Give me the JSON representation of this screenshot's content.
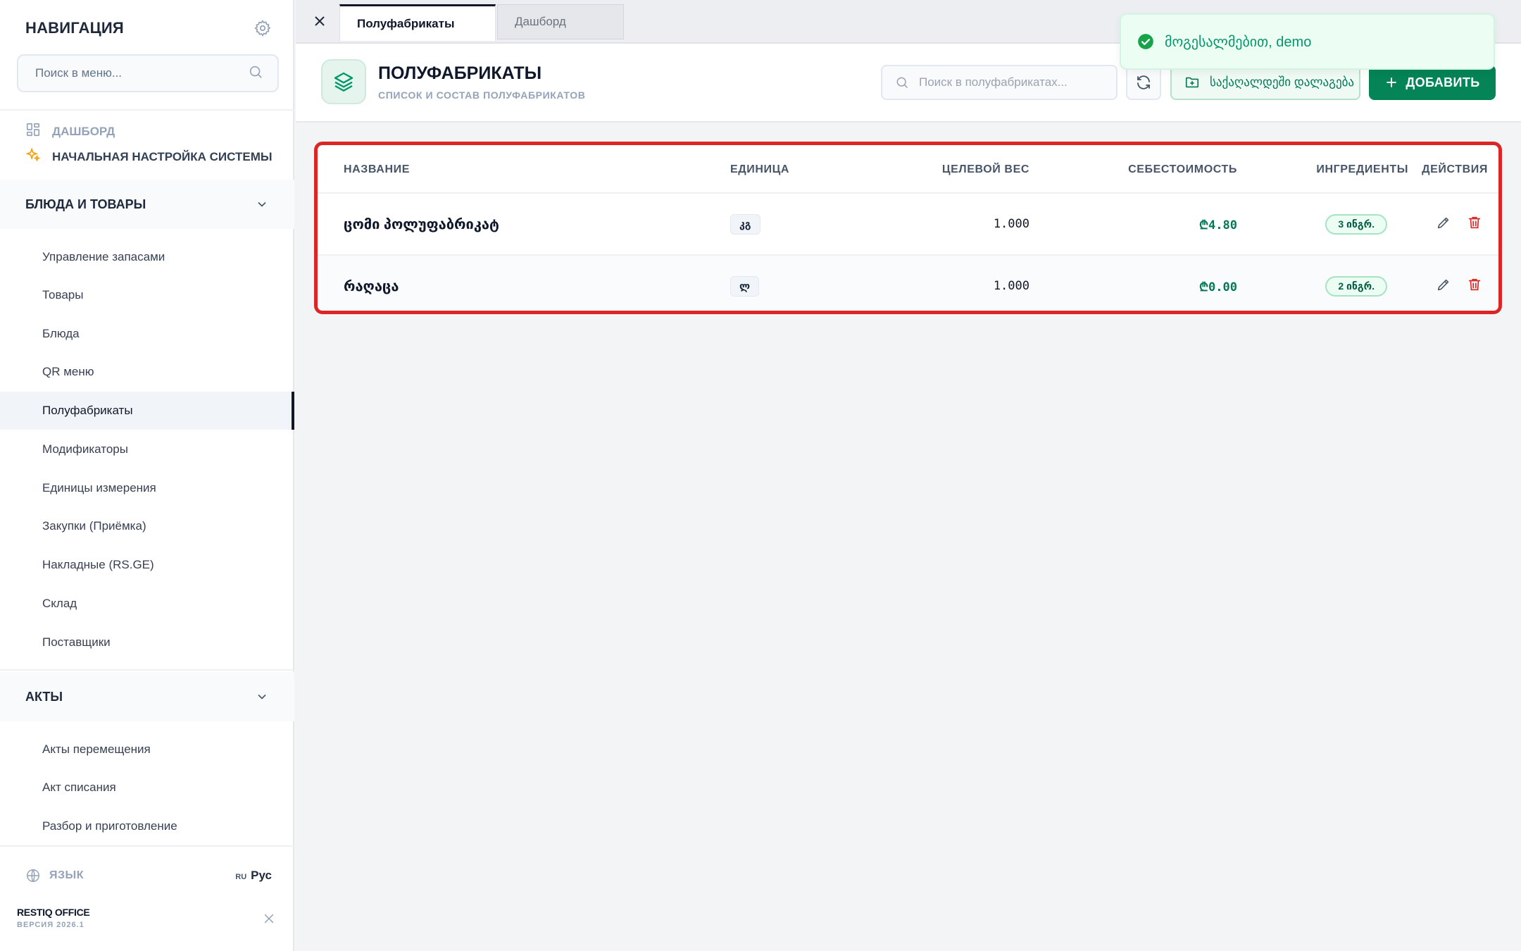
{
  "sidebar": {
    "title": "НАВИГАЦИЯ",
    "search_placeholder": "Поиск в меню...",
    "top_items": [
      {
        "label": "ДАШБОРД"
      },
      {
        "label": "НАЧАЛЬНАЯ НАСТРОЙКА СИСТЕМЫ"
      }
    ],
    "groups": [
      {
        "label": "БЛЮДА И ТОВАРЫ",
        "items": [
          {
            "label": "Управление запасами"
          },
          {
            "label": "Товары"
          },
          {
            "label": "Блюда"
          },
          {
            "label": "QR меню"
          },
          {
            "label": "Полуфабрикаты",
            "active": true
          },
          {
            "label": "Модификаторы"
          },
          {
            "label": "Единицы измерения"
          },
          {
            "label": "Закупки (Приёмка)"
          },
          {
            "label": "Накладные (RS.GE)"
          },
          {
            "label": "Склад"
          },
          {
            "label": "Поставщики"
          }
        ]
      },
      {
        "label": "АКТЫ",
        "items": [
          {
            "label": "Акты перемещения"
          },
          {
            "label": "Акт списания"
          },
          {
            "label": "Разбор и приготовление"
          }
        ]
      }
    ],
    "language": {
      "label": "ЯЗЫК",
      "code": "RU",
      "name": "Рус"
    },
    "brand": {
      "name": "RESTIQ OFFICE",
      "version": "ВЕРСИЯ 2026.1"
    }
  },
  "tabs": [
    {
      "label": "Полуфабрикаты",
      "active": true
    },
    {
      "label": "Дашборд",
      "active": false
    }
  ],
  "header": {
    "title": "ПОЛУФАБРИКАТЫ",
    "subtitle": "СПИСОК И СОСТАВ ПОЛУФАБРИКАТОВ",
    "search_placeholder": "Поиск в полуфабрикатах...",
    "folder_button": "საქაღალდეში დალაგება",
    "add_button": "ДОБАВИТЬ"
  },
  "toast": {
    "text": "მოგესალმებით, demo"
  },
  "table": {
    "columns": [
      "НАЗВАНИЕ",
      "ЕДИНИЦА",
      "ЦЕЛЕВОЙ ВЕС",
      "СЕБЕСТОИМОСТЬ",
      "ИНГРЕДИЕНТЫ",
      "ДЕЙСТВИЯ"
    ],
    "rows": [
      {
        "name": "ცომი პოლუფაბრიკატ",
        "unit": "კგ",
        "weight": "1.000",
        "cost": "₾4.80",
        "ingredients": "3 ინგრ."
      },
      {
        "name": "რაღაცა",
        "unit": "ლ",
        "weight": "1.000",
        "cost": "₾0.00",
        "ingredients": "2 ინგრ."
      }
    ]
  },
  "colors": {
    "accent": "#048457",
    "highlight_border": "#dc2626",
    "delete": "#dc2626",
    "setup_icon": "#f59e0b"
  },
  "icons": [
    "gear-icon",
    "search-icon",
    "dashboard-icon",
    "sparkles-icon",
    "chevron-down-icon",
    "globe-icon",
    "close-icon",
    "layers-icon",
    "refresh-icon",
    "folder-plus-icon",
    "plus-icon",
    "check-circle-icon",
    "pencil-icon",
    "trash-icon"
  ]
}
